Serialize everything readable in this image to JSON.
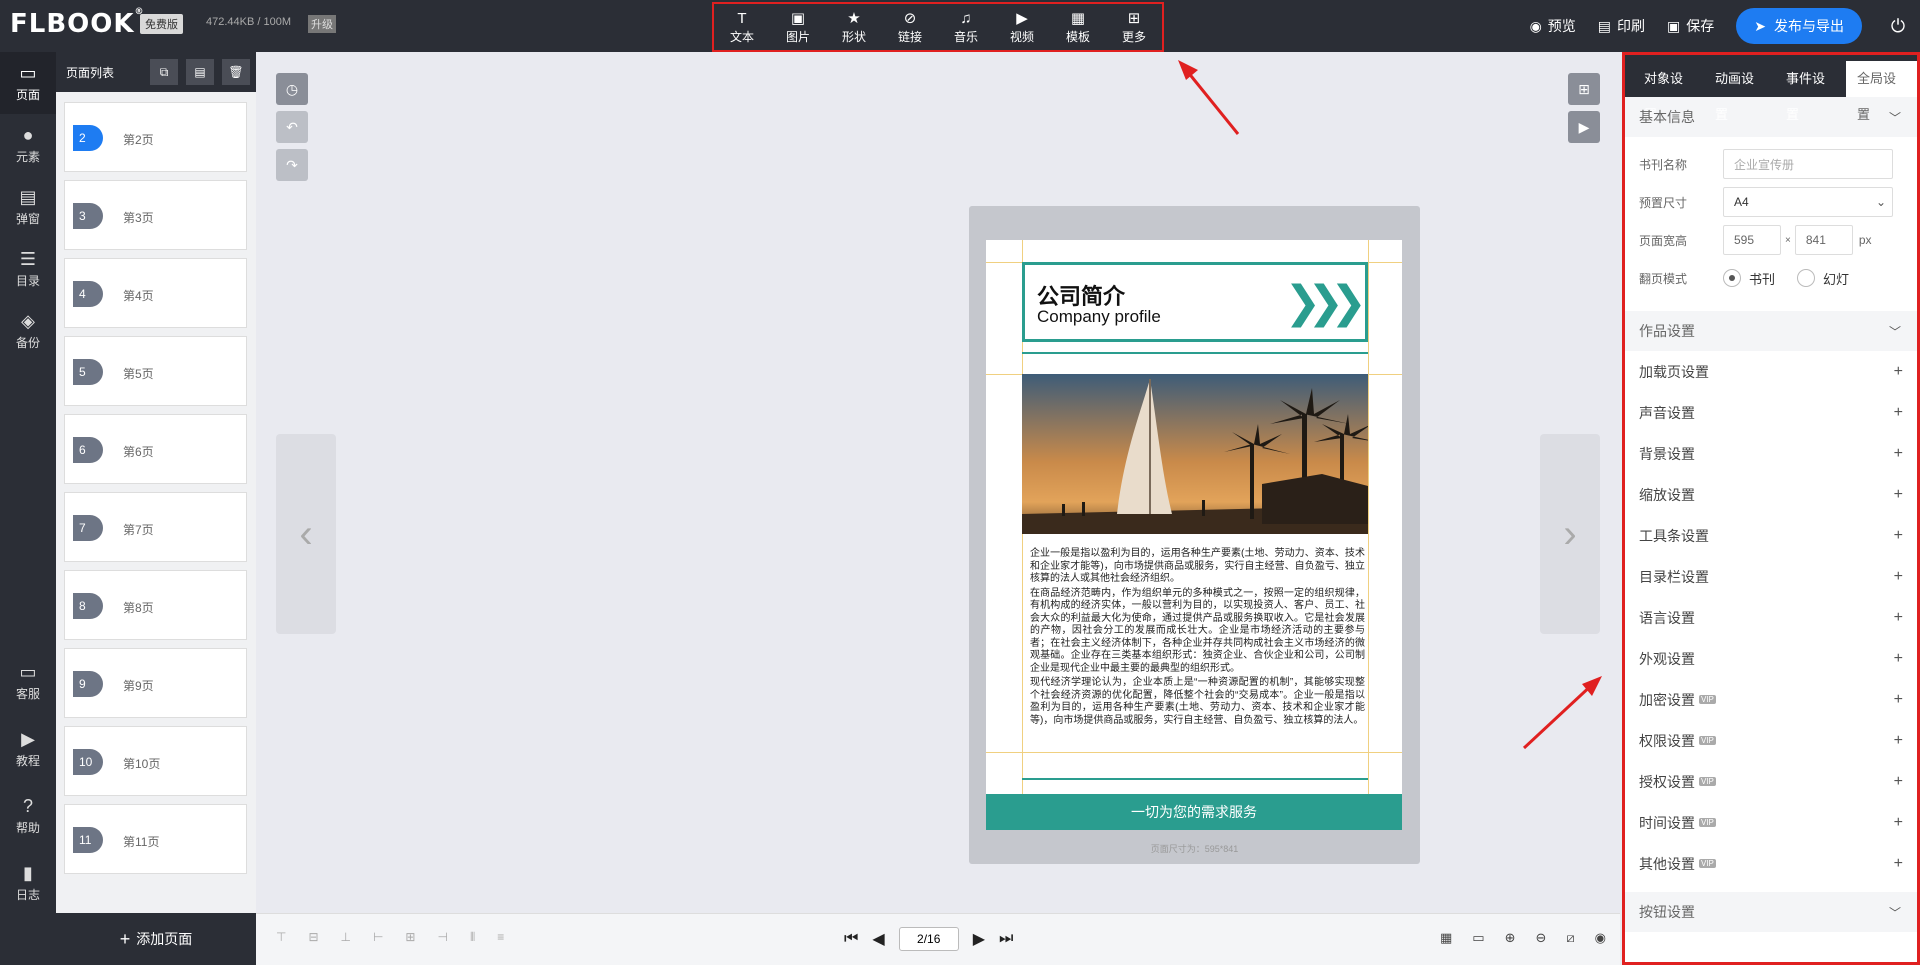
{
  "topbar": {
    "logo": "FLBOOK",
    "logo_mark": "®",
    "plan": "免费版",
    "storage": "472.44KB / 100M",
    "upgrade": "升级",
    "tools": [
      {
        "icon": "text-icon",
        "glyph": "T",
        "label": "文本"
      },
      {
        "icon": "image-icon",
        "glyph": "▣",
        "label": "图片"
      },
      {
        "icon": "star-icon",
        "glyph": "★",
        "label": "形状"
      },
      {
        "icon": "link-icon",
        "glyph": "⊘",
        "label": "链接"
      },
      {
        "icon": "music-icon",
        "glyph": "♫",
        "label": "音乐"
      },
      {
        "icon": "video-icon",
        "glyph": "▶",
        "label": "视频"
      },
      {
        "icon": "template-icon",
        "glyph": "▦",
        "label": "模板"
      },
      {
        "icon": "more-icon",
        "glyph": "⊞",
        "label": "更多"
      }
    ],
    "preview": "预览",
    "print": "印刷",
    "save": "保存",
    "publish": "发布与导出"
  },
  "leftnav": {
    "items": [
      {
        "label": "页面",
        "glyph": "▭"
      },
      {
        "label": "元素",
        "glyph": "●"
      },
      {
        "label": "弹窗",
        "glyph": "▤"
      },
      {
        "label": "目录",
        "glyph": "☰"
      },
      {
        "label": "备份",
        "glyph": "◈"
      }
    ],
    "bottom": [
      {
        "label": "客服",
        "glyph": "▭"
      },
      {
        "label": "教程",
        "glyph": "▶"
      },
      {
        "label": "帮助",
        "glyph": "?"
      },
      {
        "label": "日志",
        "glyph": "▮"
      }
    ]
  },
  "pages": {
    "title": "页面列表",
    "add": "添加页面",
    "items": [
      {
        "num": "2",
        "label": "第2页"
      },
      {
        "num": "3",
        "label": "第3页"
      },
      {
        "num": "4",
        "label": "第4页"
      },
      {
        "num": "5",
        "label": "第5页"
      },
      {
        "num": "6",
        "label": "第6页"
      },
      {
        "num": "7",
        "label": "第7页"
      },
      {
        "num": "8",
        "label": "第8页"
      },
      {
        "num": "9",
        "label": "第9页"
      },
      {
        "num": "10",
        "label": "第10页"
      },
      {
        "num": "11",
        "label": "第11页"
      }
    ]
  },
  "doc": {
    "title_cn": "公司简介",
    "title_en": "Company profile",
    "para1": "企业一般是指以盈利为目的，运用各种生产要素(土地、劳动力、资本、技术和企业家才能等)，向市场提供商品或服务，实行自主经营、自负盈亏、独立核算的法人或其他社会经济组织。",
    "para2": "在商品经济范畴内，作为组织单元的多种模式之一，按照一定的组织规律，有机构成的经济实体，一般以营利为目的，以实现投资人、客户、员工、社会大众的利益最大化为使命，通过提供产品或服务换取收入。它是社会发展的产物，因社会分工的发展而成长壮大。企业是市场经济活动的主要参与者；在社会主义经济体制下，各种企业并存共同构成社会主义市场经济的微观基础。企业存在三类基本组织形式：独资企业、合伙企业和公司，公司制企业是现代企业中最主要的最典型的组织形式。",
    "para3": "现代经济学理论认为，企业本质上是“一种资源配置的机制”，其能够实现整个社会经济资源的优化配置，降低整个社会的“交易成本”。企业一般是指以盈利为目的，运用各种生产要素(土地、劳动力、资本、技术和企业家才能等)，向市场提供商品或服务，实行自主经营、自负盈亏、独立核算的法人。",
    "footer": "一切为您的需求服务",
    "size_note": "页面尺寸为：595*841"
  },
  "pager": {
    "current": "2/16"
  },
  "panel": {
    "tabs": [
      "对象设置",
      "动画设置",
      "事件设置",
      "全局设置"
    ],
    "basic": "基本信息",
    "name_label": "书刊名称",
    "name_placeholder": "企业宣传册",
    "preset_label": "预置尺寸",
    "preset_value": "A4",
    "wh_label": "页面宽高",
    "width": "595",
    "height": "841",
    "unit": "px",
    "times": "×",
    "flip_label": "翻页模式",
    "flip_book": "书刊",
    "flip_slide": "幻灯",
    "work": "作品设置",
    "rows": [
      {
        "label": "加载页设置",
        "vip": false
      },
      {
        "label": "声音设置",
        "vip": false
      },
      {
        "label": "背景设置",
        "vip": false
      },
      {
        "label": "缩放设置",
        "vip": false
      },
      {
        "label": "工具条设置",
        "vip": false
      },
      {
        "label": "目录栏设置",
        "vip": false
      },
      {
        "label": "语言设置",
        "vip": false
      },
      {
        "label": "外观设置",
        "vip": false
      },
      {
        "label": "加密设置",
        "vip": true
      },
      {
        "label": "权限设置",
        "vip": true
      },
      {
        "label": "授权设置",
        "vip": true
      },
      {
        "label": "时间设置",
        "vip": true
      },
      {
        "label": "其他设置",
        "vip": true
      }
    ],
    "vip_tag": "VIP",
    "buttons": "按钮设置"
  }
}
